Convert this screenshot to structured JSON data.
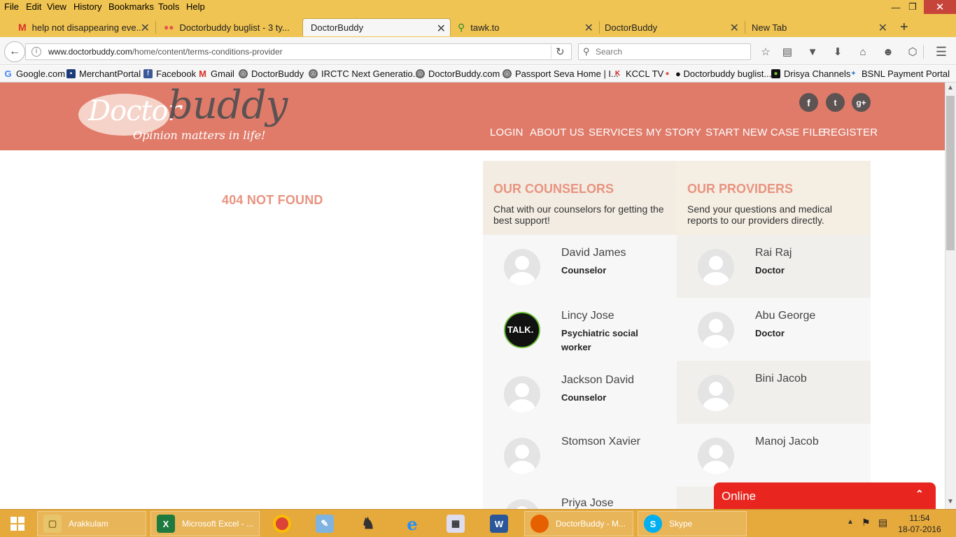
{
  "menubar": {
    "items": [
      "File",
      "Edit",
      "View",
      "History",
      "Bookmarks",
      "Tools",
      "Help"
    ]
  },
  "tabs": [
    {
      "label": "help not disappearing eve...",
      "icon": "gmail-icon"
    },
    {
      "label": "Doctorbuddy buglist - 3 ty...",
      "icon": "asana-icon"
    },
    {
      "label": "DoctorBuddy",
      "icon": "none"
    },
    {
      "label": "tawk.to",
      "icon": "tawk-icon"
    },
    {
      "label": "DoctorBuddy",
      "icon": "none"
    },
    {
      "label": "New Tab",
      "icon": "none"
    }
  ],
  "urlbar": {
    "domain": "www.doctorbuddy.com",
    "path": "/home/content/terms-conditions-provider"
  },
  "searchbar": {
    "placeholder": "Search"
  },
  "bookmarks": [
    "Google.com",
    "MerchantPortal",
    "Facebook",
    "Gmail",
    "DoctorBuddy",
    "IRCTC Next Generatio...",
    "DoctorBuddy.com",
    "Passport Seva Home | I...",
    "KCCL TV",
    "● Doctorbuddy buglist...",
    "Drisya Channels",
    "BSNL Payment Portal"
  ],
  "site": {
    "logo_word1": "Doctor",
    "logo_word2": "buddy",
    "tagline": "Opinion matters in life!",
    "nav": [
      "LOGIN",
      "ABOUT US",
      "SERVICES",
      "MY STORY",
      "START NEW CASE FILE",
      "REGISTER"
    ],
    "social": [
      "f",
      "t",
      "g+"
    ],
    "colors": {
      "header": "#e07b6a",
      "accent": "#e89480"
    }
  },
  "main": {
    "message": "404 NOT FOUND"
  },
  "counselors": {
    "title": "OUR COUNSELORS",
    "desc": "Chat with our counselors for getting the best support!",
    "people": [
      {
        "name": "David James",
        "role": "Counselor"
      },
      {
        "name": "Lincy Jose",
        "role": "Psychiatric social worker",
        "avatar_text": "TALK."
      },
      {
        "name": "Jackson David",
        "role": "Counselor"
      },
      {
        "name": "Stomson Xavier",
        "role": ""
      },
      {
        "name": "Priya Jose",
        "role": ""
      }
    ]
  },
  "providers": {
    "title": "OUR PROVIDERS",
    "desc": "Send your questions and medical reports to our providers directly.",
    "people": [
      {
        "name": "Rai Raj",
        "role": "Doctor"
      },
      {
        "name": "Abu George",
        "role": "Doctor"
      },
      {
        "name": "Bini Jacob",
        "role": ""
      },
      {
        "name": "Manoj Jacob",
        "role": ""
      }
    ]
  },
  "chat_widget": {
    "label": "Online"
  },
  "taskbar": {
    "items": [
      "Arakkulam",
      "Microsoft Excel - ...",
      "DoctorBuddy - M...",
      "Skype"
    ],
    "time": "11:54",
    "date": "18-07-2016"
  }
}
